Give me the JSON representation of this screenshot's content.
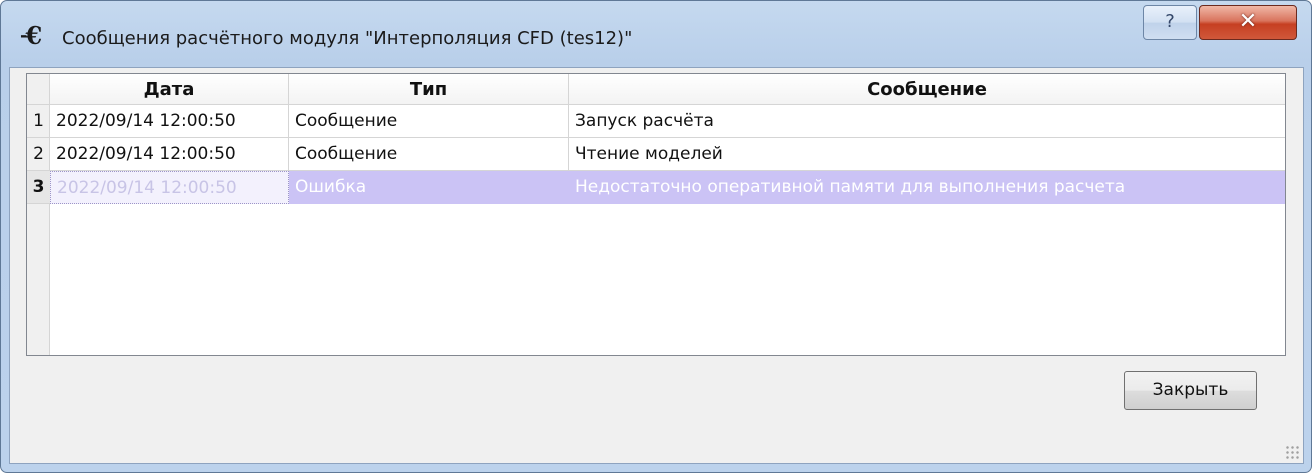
{
  "window": {
    "icon": "€",
    "title": "Сообщения расчётного модуля \"Интерполяция CFD (tes12)\"",
    "help_label": "?",
    "close_label": "✕"
  },
  "table": {
    "columns": [
      "Дата",
      "Тип",
      "Сообщение"
    ],
    "rows": [
      {
        "num": "1",
        "date": "2022/09/14 12:00:50",
        "type": "Сообщение",
        "message": "Запуск расчёта"
      },
      {
        "num": "2",
        "date": "2022/09/14 12:00:50",
        "type": "Сообщение",
        "message": "Чтение моделей"
      },
      {
        "num": "3",
        "date": "2022/09/14 12:00:50",
        "type": "Ошибка",
        "message": "Недостаточно оперативной памяти для выполнения расчета"
      }
    ],
    "selected_row": 3
  },
  "footer": {
    "close_button": "Закрыть"
  }
}
